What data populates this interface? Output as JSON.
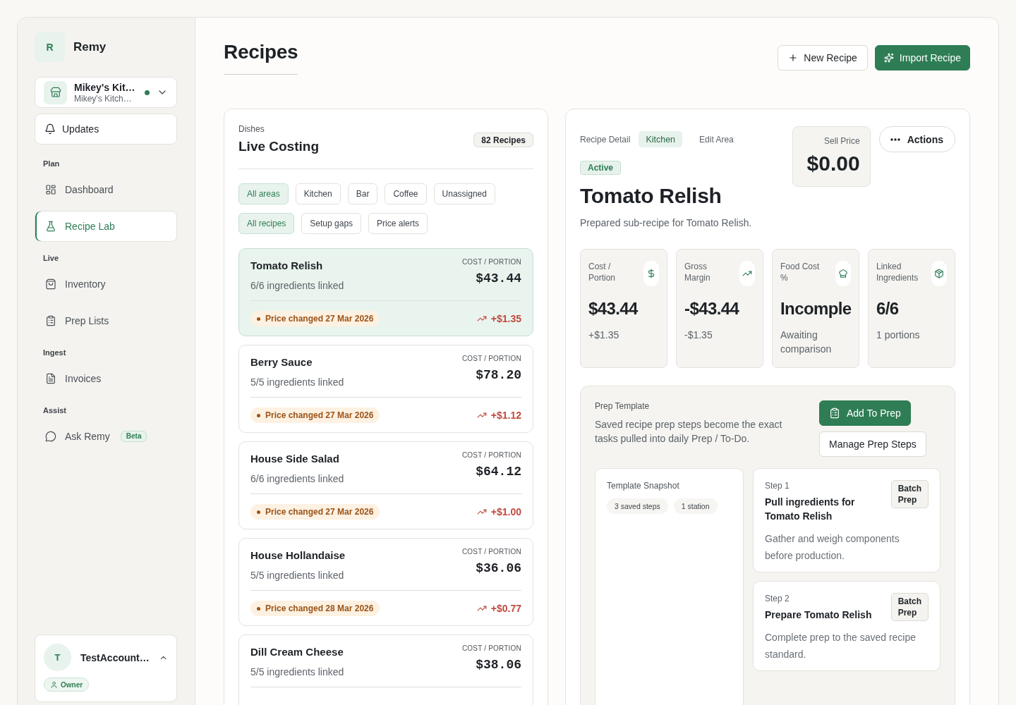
{
  "sidebar": {
    "brand": {
      "initial": "R",
      "name": "Remy"
    },
    "location": {
      "name": "Mikey's Kit…",
      "subtitle": "Mikey's Kitch…",
      "online": true
    },
    "updates": "Updates",
    "sections": [
      {
        "label": "Plan",
        "items": [
          {
            "kind": "dashboard",
            "label": "Dashboard",
            "selected": false
          },
          {
            "kind": "lab",
            "label": "Recipe Lab",
            "selected": true
          }
        ]
      },
      {
        "label": "Live",
        "items": [
          {
            "kind": "inventory",
            "label": "Inventory",
            "selected": false
          },
          {
            "kind": "prep",
            "label": "Prep Lists",
            "selected": false
          }
        ]
      },
      {
        "label": "Ingest",
        "items": [
          {
            "kind": "invoices",
            "label": "Invoices",
            "selected": false
          }
        ]
      },
      {
        "label": "Assist",
        "items": [
          {
            "kind": "assistant",
            "label": "Ask Remy",
            "badge": "Beta",
            "selected": false
          }
        ]
      }
    ],
    "account": {
      "initial": "T",
      "name": "TestAccount…",
      "role": "Owner"
    }
  },
  "header": {
    "title": "Recipes",
    "buttons": [
      {
        "kind": "create",
        "label": "New Recipe"
      },
      {
        "kind": "import",
        "label": "Import Recipe"
      }
    ]
  },
  "costing": {
    "eyebrow": "Dishes",
    "title": "Live Costing",
    "count": "82 Recipes",
    "area_filters": [
      {
        "label": "All areas",
        "selected": true
      },
      {
        "label": "Kitchen",
        "selected": false
      },
      {
        "label": "Bar",
        "selected": false
      },
      {
        "label": "Coffee",
        "selected": false
      },
      {
        "label": "Unassigned",
        "selected": false
      }
    ],
    "recipe_filters": [
      {
        "label": "All recipes",
        "selected": true
      },
      {
        "label": "Setup gaps",
        "selected": false
      },
      {
        "label": "Price alerts",
        "selected": false
      }
    ],
    "recipes": [
      {
        "name": "Tomato Relish",
        "ingredients": "6/6 ingredients linked",
        "cost_label": "COST / PORTION",
        "cost": "$43.44",
        "alert": "Price changed 27 Mar 2026",
        "change": "+$1.35",
        "selected": true
      },
      {
        "name": "Berry Sauce",
        "ingredients": "5/5 ingredients linked",
        "cost_label": "COST / PORTION",
        "cost": "$78.20",
        "alert": "Price changed 27 Mar 2026",
        "change": "+$1.12",
        "selected": false
      },
      {
        "name": "House Side Salad",
        "ingredients": "6/6 ingredients linked",
        "cost_label": "COST / PORTION",
        "cost": "$64.12",
        "alert": "Price changed 27 Mar 2026",
        "change": "+$1.00",
        "selected": false
      },
      {
        "name": "House Hollandaise",
        "ingredients": "5/5 ingredients linked",
        "cost_label": "COST / PORTION",
        "cost": "$36.06",
        "alert": "Price changed 28 Mar 2026",
        "change": "+$0.77",
        "selected": false
      },
      {
        "name": "Dill Cream Cheese",
        "ingredients": "5/5 ingredients linked",
        "cost_label": "COST / PORTION",
        "cost": "$38.06",
        "selected": false
      }
    ]
  },
  "detail": {
    "breadcrumb": "Recipe Detail",
    "area": "Kitchen",
    "edit_area": "Edit Area",
    "sell_price": {
      "label": "Sell Price",
      "value": "$0.00"
    },
    "actions": "Actions",
    "status": "Active",
    "title": "Tomato Relish",
    "description": "Prepared sub-recipe for Tomato Relish.",
    "stats": [
      {
        "kind": "cost",
        "label": "Cost / Portion",
        "value": "$43.44",
        "note": "+$1.35"
      },
      {
        "kind": "margin",
        "label": "Gross Margin",
        "value": "-$43.44",
        "note": "-$1.35"
      },
      {
        "kind": "foodcost",
        "label": "Food Cost %",
        "value": "Incomple",
        "note": "Awaiting comparison"
      },
      {
        "kind": "linked",
        "label": "Linked Ingredients",
        "value": "6/6",
        "note": "1 portions"
      }
    ],
    "prep": {
      "label": "Prep Template",
      "description": "Saved recipe prep steps become the exact tasks pulled into daily Prep / To-Do.",
      "buttons": [
        {
          "kind": "add",
          "label": "Add To Prep"
        },
        {
          "kind": "manage",
          "label": "Manage Prep Steps"
        }
      ],
      "snapshot": {
        "title": "Template Snapshot",
        "chips": [
          "3 saved steps",
          "1 station"
        ]
      },
      "steps": [
        {
          "step": "Step 1",
          "title": "Pull ingredients for Tomato Relish",
          "tag": "Batch Prep",
          "description": "Gather and weigh components before production."
        },
        {
          "step": "Step 2",
          "title": "Prepare Tomato Relish",
          "tag": "Batch Prep",
          "description": "Complete prep to the saved recipe standard."
        }
      ]
    }
  }
}
